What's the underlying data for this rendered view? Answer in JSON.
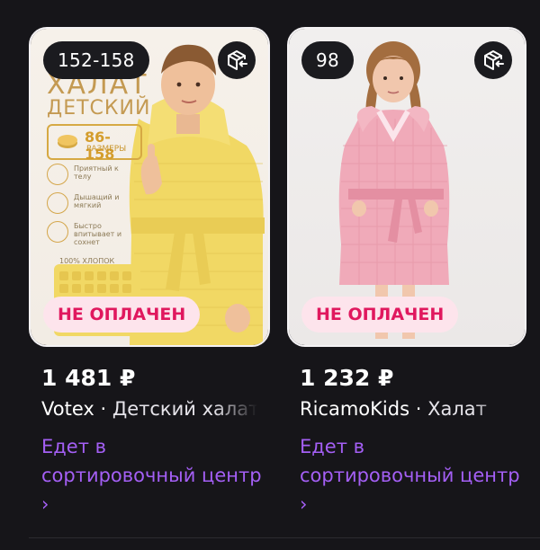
{
  "products": [
    {
      "size_badge": "152-158",
      "status": "НЕ ОПЛАЧЕН",
      "price": "1 481 ₽",
      "brand": "Votex",
      "separator": " · ",
      "name": "Детский халат",
      "delivery": "Едет в сортировочный центр ›",
      "promo": {
        "line1": "ХАЛАТ",
        "line2": "ДЕТСКИЙ",
        "size_range": "86-158",
        "size_label": "РАЗМЕРЫ",
        "features": [
          "Приятный к телу",
          "Дышащий и мягкий",
          "Быстро впитывает и сохнет"
        ],
        "material": "100% ХЛОПОК"
      },
      "robe_color": "#f3dc6a"
    },
    {
      "size_badge": "98",
      "status": "НЕ ОПЛАЧЕН",
      "price": "1 232 ₽",
      "brand": "RicamoKids",
      "separator": " · ",
      "name": "Халат",
      "delivery": "Едет в сортировочный центр ›",
      "robe_color": "#f0aab9"
    }
  ],
  "icons": {
    "return": "box-return-icon"
  },
  "colors": {
    "background": "#161519",
    "status_bg": "#fde4ec",
    "status_text": "#e0185e",
    "delivery_text": "#a45ff5"
  }
}
